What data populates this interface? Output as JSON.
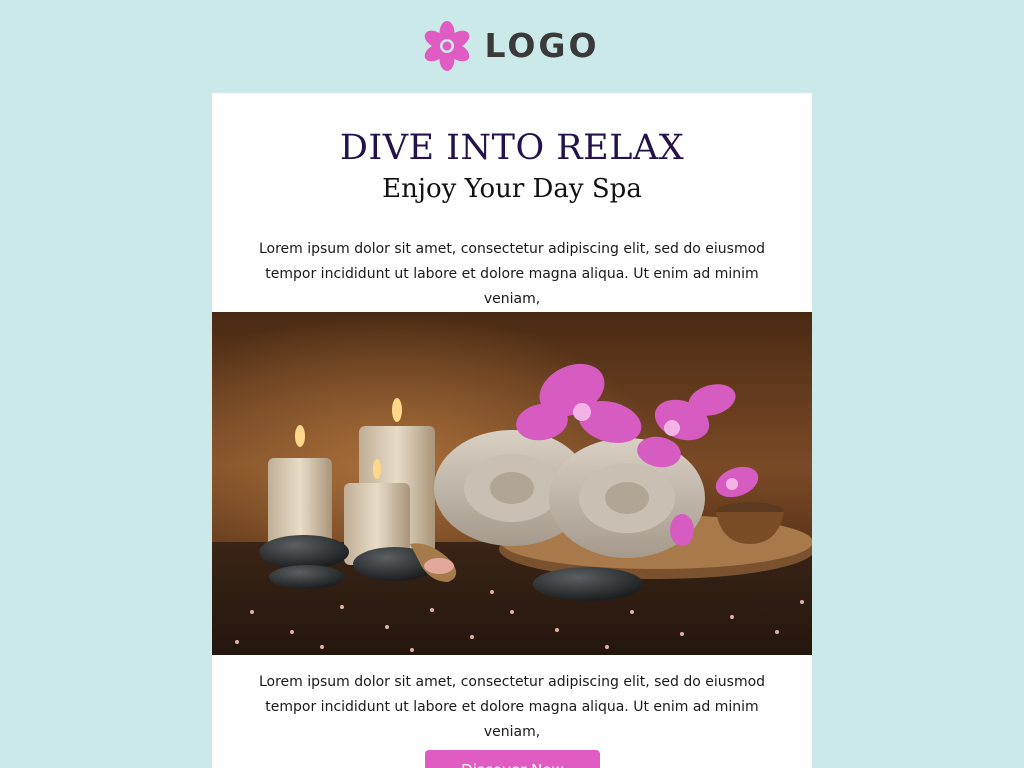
{
  "header": {
    "logo_text": "LOGO",
    "logo_icon": "flower-icon",
    "brand_color": "#e05cc3"
  },
  "hero": {
    "title": "DIVE INTO RELAX",
    "subtitle": "Enjoy Your Day Spa",
    "intro_line1": "Lorem ipsum dolor sit amet, consectetur adipiscing elit, sed do eiusmod",
    "intro_line2": "tempor incididunt ut labore et dolore magna aliqua. Ut enim ad minim veniam,"
  },
  "image": {
    "icon": "spa-photo"
  },
  "content": {
    "line1": "Lorem ipsum dolor sit amet, consectetur adipiscing elit, sed do eiusmod",
    "line2": "tempor incididunt ut labore et dolore magna aliqua. Ut enim ad minim veniam,"
  },
  "cta": {
    "label": "Discover Now"
  },
  "colors": {
    "background": "#cce9ea",
    "title": "#24124a",
    "button": "#e05cc3"
  }
}
